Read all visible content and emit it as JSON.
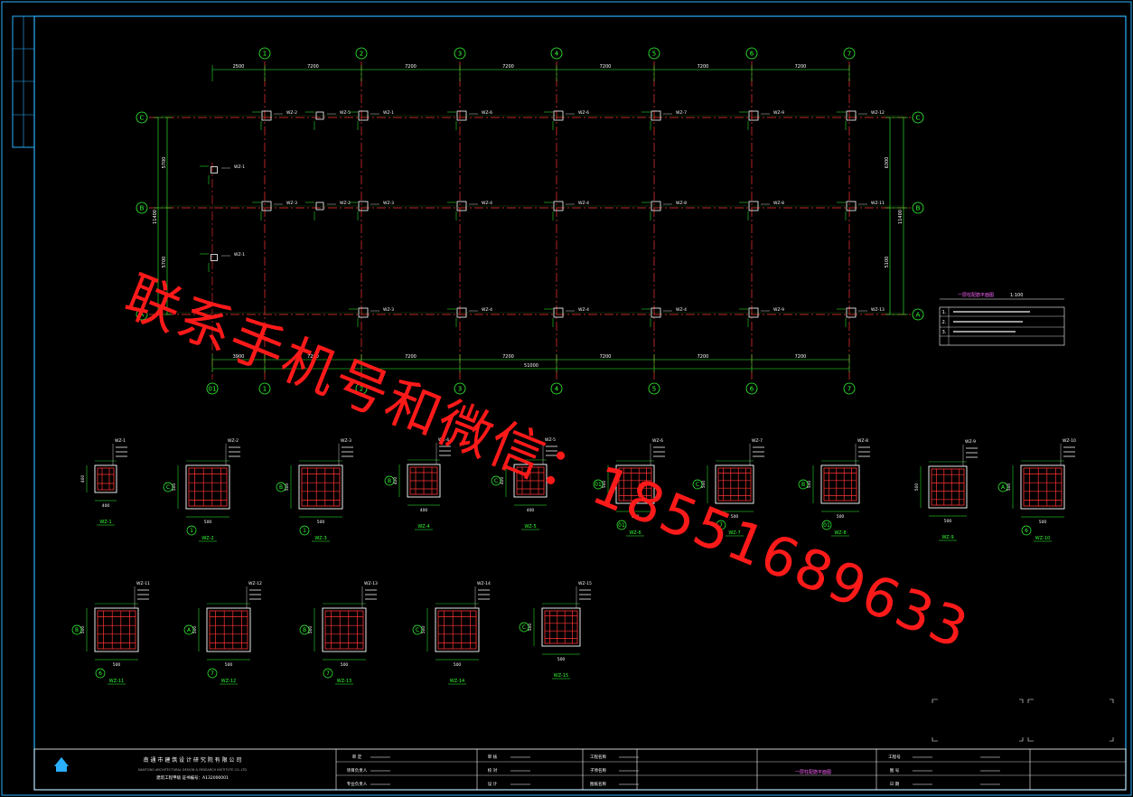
{
  "drawing": {
    "grid_columns": [
      "1",
      "2",
      "3",
      "4",
      "5",
      "6",
      "7"
    ],
    "grid_rows": [
      "C",
      "B",
      "A"
    ],
    "edge_axis": "01",
    "dim_top": [
      "2500",
      "7200",
      "7200",
      "7200",
      "7200",
      "7200",
      "7200"
    ],
    "dim_bottom": [
      "3900",
      "7200",
      "7200",
      "7200",
      "7200",
      "7200",
      "7200"
    ],
    "dim_total": "51000",
    "dim_left": [
      "5700",
      "5700"
    ],
    "dim_left_total": "11400",
    "dim_right": [
      "6300",
      "5100"
    ],
    "dim_right_total": "11400",
    "column_tags": [
      "WZ-1",
      "WZ-2",
      "WZ-3",
      "WZ-4",
      "WZ-5",
      "WZ-6",
      "WZ-7",
      "WZ-8",
      "WZ-9",
      "WZ-10",
      "WZ-11",
      "WZ-12",
      "WZ-13",
      "WZ-14",
      "WZ-15"
    ],
    "section_widths": [
      "400",
      "500",
      "500",
      "400",
      "400",
      "500",
      "500",
      "500",
      "500",
      "500",
      "500",
      "500",
      "500",
      "500",
      "500"
    ],
    "notes_title": "一层柱配筋平面图",
    "notes_scale": "1:100",
    "notes": [
      "1.",
      "2.",
      "3."
    ]
  },
  "title_block": {
    "company": "南 通 市 建 筑 设 计 研 究 院 有 限 公 司",
    "company_en": "NANTONG ARCHITECTURAL DESIGN & RESEARCH INSTITUTE CO.,LTD",
    "cert_label": "建筑工程甲级 证书编号：A132000001",
    "drawing_title": "一层柱配筋平面图",
    "rows_left": [
      "审 定",
      "项目负责人",
      "专业负责人"
    ],
    "rows_mid": [
      "审 核",
      "校 对",
      "设 计"
    ],
    "rows_right": [
      "工程名称",
      "子项名称",
      "图纸名称"
    ],
    "info_right": [
      "工程号",
      "图 号",
      "日 期"
    ]
  },
  "watermark": {
    "text": "联系手机号和微信：18551689633"
  }
}
